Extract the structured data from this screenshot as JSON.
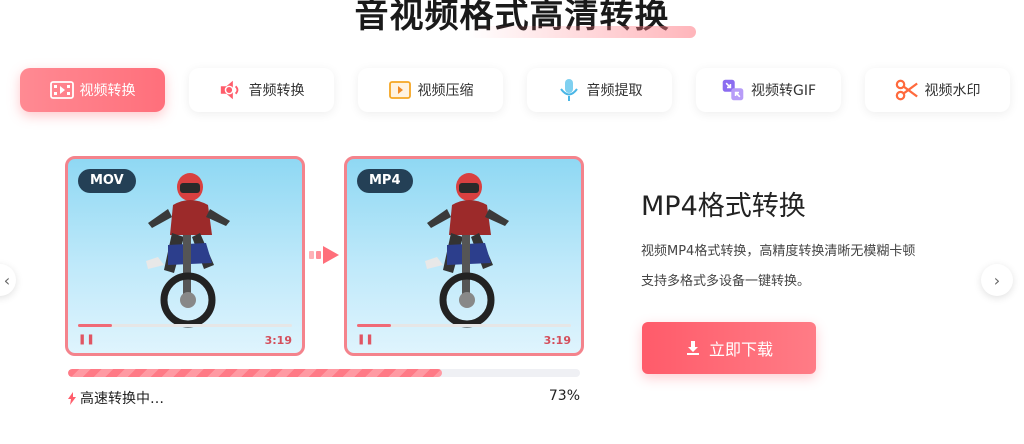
{
  "header": {
    "title": "音视频格式高清转换"
  },
  "tabs": [
    {
      "label": "视频转换",
      "icon": "film-icon",
      "active": true
    },
    {
      "label": "音频转换",
      "icon": "audio-convert-icon",
      "active": false
    },
    {
      "label": "视频压缩",
      "icon": "video-compress-icon",
      "active": false
    },
    {
      "label": "音频提取",
      "icon": "microphone-icon",
      "active": false
    },
    {
      "label": "视频转GIF",
      "icon": "gif-convert-icon",
      "active": false
    },
    {
      "label": "视频水印",
      "icon": "scissors-icon",
      "active": false
    }
  ],
  "preview": {
    "source": {
      "format": "MOV",
      "time": "3:19"
    },
    "target": {
      "format": "MP4",
      "time": "3:19"
    }
  },
  "progress": {
    "label": "高速转换中…",
    "percent_text": "73%",
    "percent": 73
  },
  "info": {
    "title": "MP4格式转换",
    "line1": "视频MP4格式转换，高精度转换清晰无模糊卡顿",
    "line2": "支持多格式多设备一键转换。",
    "download_label": "立即下载"
  },
  "colors": {
    "accent": "#ff6f7b",
    "card_border": "#f4838c",
    "badge_bg": "#244056"
  }
}
